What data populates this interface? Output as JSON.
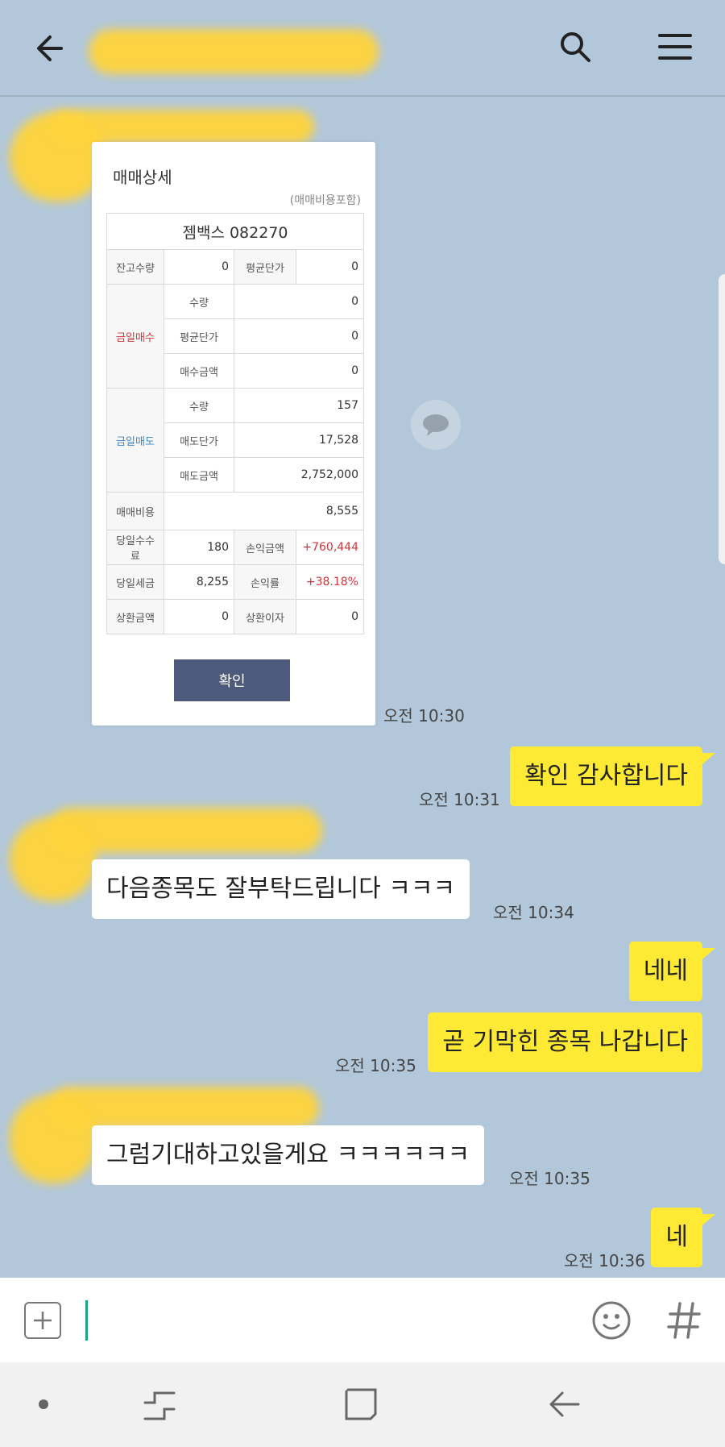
{
  "chat": {
    "card": {
      "title": "매매상세",
      "note": "(매매비용포함)",
      "stock": "젬백스 082270",
      "rows": {
        "balance_qty_label": "잔고수량",
        "balance_qty": "0",
        "avg_price_label": "평균단가",
        "avg_price": "0",
        "buy_label": "금일매수",
        "buy_qty_label": "수량",
        "buy_qty": "0",
        "buy_avg_label": "평균단가",
        "buy_avg": "0",
        "buy_amt_label": "매수금액",
        "buy_amt": "0",
        "sell_label": "금일매도",
        "sell_qty_label": "수량",
        "sell_qty": "157",
        "sell_price_label": "매도단가",
        "sell_price": "17,528",
        "sell_amt_label": "매도금액",
        "sell_amt": "2,752,000",
        "cost_label": "매매비용",
        "cost": "8,555",
        "fee_label": "당일수수료",
        "fee": "180",
        "pnl_label": "손익금액",
        "pnl": "+760,444",
        "tax_label": "당일세금",
        "tax": "8,255",
        "pnl_rate_label": "손익률",
        "pnl_rate": "+38.18%",
        "repay_amt_label": "상환금액",
        "repay_amt": "0",
        "repay_int_label": "상환이자",
        "repay_int": "0"
      },
      "confirm_label": "확인"
    },
    "messages": [
      {
        "from": "other",
        "text": "",
        "time": "오전 10:30"
      },
      {
        "from": "me",
        "text": "확인 감사합니다",
        "time": "오전 10:31"
      },
      {
        "from": "other",
        "text": "다음종목도 잘부탁드립니다 ㅋㅋㅋ",
        "time": "오전 10:34"
      },
      {
        "from": "me",
        "text": "네네",
        "time": ""
      },
      {
        "from": "me",
        "text": "곧 기막힌 종목 나갑니다",
        "time": "오전 10:35"
      },
      {
        "from": "other",
        "text": "그럼기대하고있을게요 ㅋㅋㅋㅋㅋㅋ",
        "time": "오전 10:35"
      },
      {
        "from": "me",
        "text": "네",
        "time": "오전 10:36"
      }
    ]
  },
  "input": {
    "placeholder": ""
  },
  "colors": {
    "chat_bg": "#b2c7da",
    "my_bubble": "#fee934",
    "confirm_button": "#4d5a7c",
    "profit": "#d0363a"
  }
}
